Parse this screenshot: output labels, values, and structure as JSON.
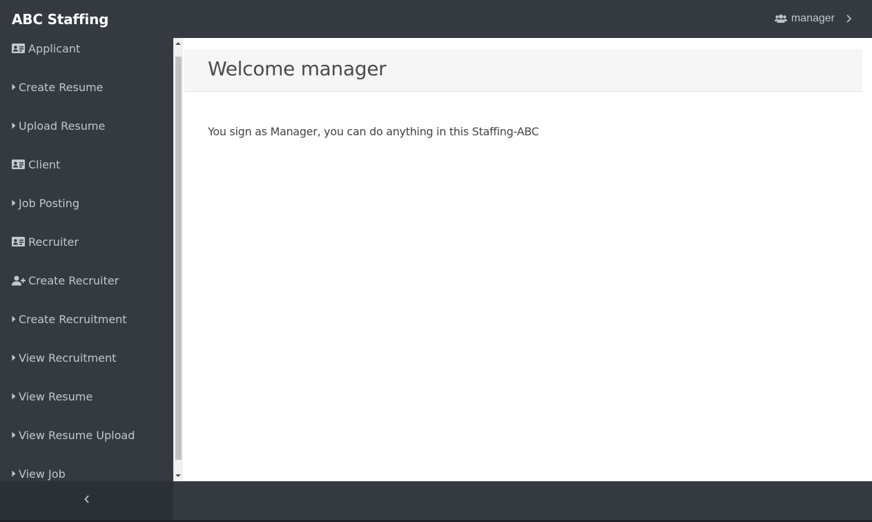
{
  "app": {
    "brand": "ABC Staffing"
  },
  "user": {
    "name": "manager",
    "icon": "users-icon",
    "chevron_icon": "chevron-right-icon"
  },
  "sidebar": {
    "items": [
      {
        "label": "Applicant",
        "icon": "id-card-icon"
      },
      {
        "label": "Create Resume",
        "icon": "caret-right-icon"
      },
      {
        "label": "Upload Resume",
        "icon": "caret-right-icon"
      },
      {
        "label": "Client",
        "icon": "id-card-icon"
      },
      {
        "label": "Job Posting",
        "icon": "caret-right-icon"
      },
      {
        "label": "Recruiter",
        "icon": "id-card-icon"
      },
      {
        "label": "Create Recruiter",
        "icon": "user-plus-icon"
      },
      {
        "label": "Create Recruitment",
        "icon": "caret-right-icon"
      },
      {
        "label": "View Recruitment",
        "icon": "caret-right-icon"
      },
      {
        "label": "View Resume",
        "icon": "caret-right-icon"
      },
      {
        "label": "View Resume Upload",
        "icon": "caret-right-icon"
      },
      {
        "label": "View Job",
        "icon": "caret-right-icon"
      }
    ],
    "collapse_icon": "chevron-left-icon"
  },
  "main": {
    "title": "Welcome manager",
    "message": "You sign as Manager, you can do anything in this Staffing-ABC"
  },
  "colors": {
    "topbar": "#343a40",
    "sidebar": "#343a40",
    "sidebar_text": "#c2c7d0",
    "content_bg": "#ffffff",
    "header_bg": "#f6f6f6"
  }
}
